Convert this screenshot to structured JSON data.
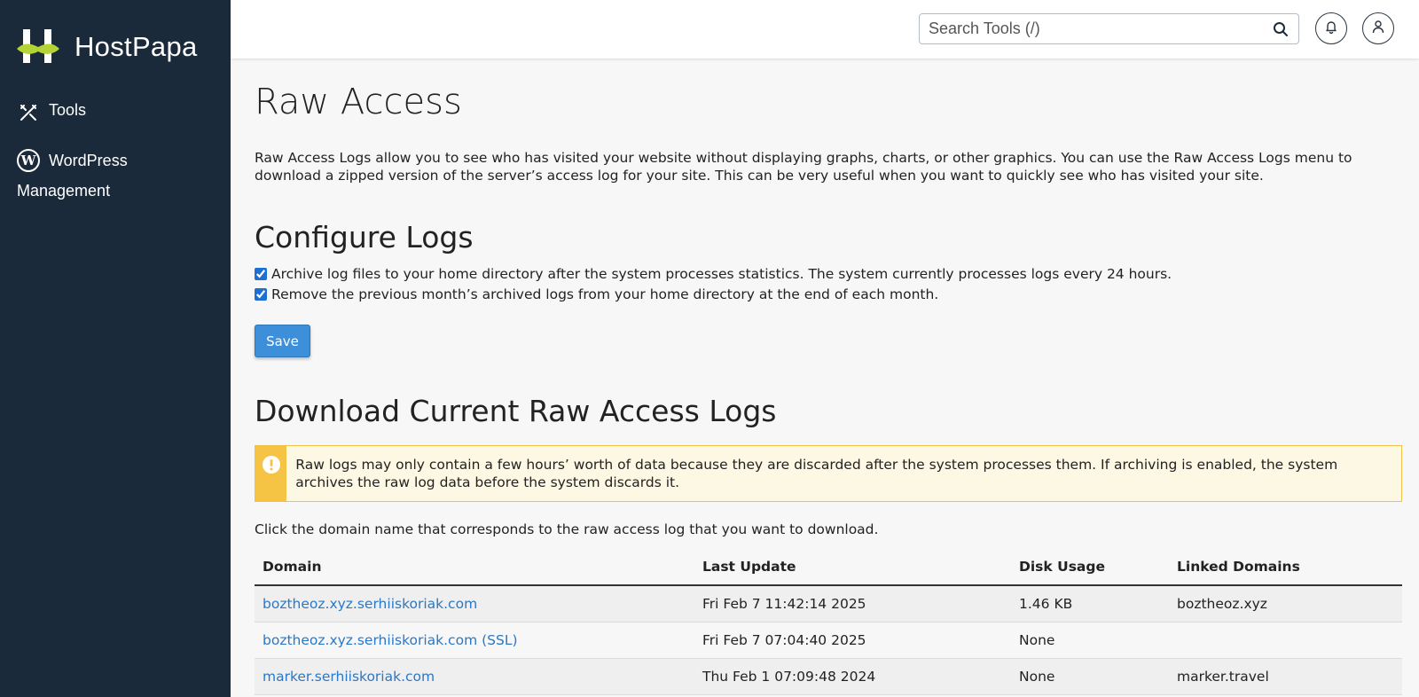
{
  "brand": {
    "name": "HostPapa"
  },
  "sidebar": {
    "items": [
      {
        "label": "Tools",
        "icon": "tools-icon"
      },
      {
        "label": "WordPress Management",
        "icon": "wordpress-icon"
      }
    ]
  },
  "header": {
    "search": {
      "placeholder": "Search Tools (/)"
    },
    "icons": [
      "search-icon",
      "bell-icon",
      "user-icon"
    ]
  },
  "page": {
    "title": "Raw Access",
    "intro": "Raw Access Logs allow you to see who has visited your website without displaying graphs, charts, or other graphics. You can use the Raw Access Logs menu to download a zipped version of the server’s access log for your site. This can be very useful when you want to quickly see who has visited your site."
  },
  "configure": {
    "heading": "Configure Logs",
    "options": [
      {
        "label": "Archive log files to your home directory after the system processes statistics. The system currently processes logs every 24 hours.",
        "checked": true
      },
      {
        "label": "Remove the previous month’s archived logs from your home directory at the end of each month.",
        "checked": true
      }
    ],
    "save_label": "Save"
  },
  "download": {
    "heading": "Download Current Raw Access Logs",
    "warning": "Raw logs may only contain a few hours’ worth of data because they are discarded after the system processes them. If archiving is enabled, the system archives the raw log data before the system discards it.",
    "instruction": "Click the domain name that corresponds to the raw access log that you want to download.",
    "table": {
      "headers": [
        "Domain",
        "Last Update",
        "Disk Usage",
        "Linked Domains"
      ],
      "rows": [
        {
          "domain": "boztheoz.xyz.serhiiskoriak.com",
          "last_update": "Fri Feb 7 11:42:14 2025",
          "disk_usage": "1.46 KB",
          "linked": "boztheoz.xyz"
        },
        {
          "domain": "boztheoz.xyz.serhiiskoriak.com (SSL)",
          "last_update": "Fri Feb 7 07:04:40 2025",
          "disk_usage": "None",
          "linked": ""
        },
        {
          "domain": "marker.serhiiskoriak.com",
          "last_update": "Thu Feb 1 07:09:48 2024",
          "disk_usage": "None",
          "linked": "marker.travel"
        }
      ]
    }
  },
  "colors": {
    "sidebar_bg": "#1b2a3b",
    "accent": "#3c8fd8",
    "link": "#2a78c6",
    "warning": "#f6c445",
    "logo_green": "#b4d334"
  }
}
